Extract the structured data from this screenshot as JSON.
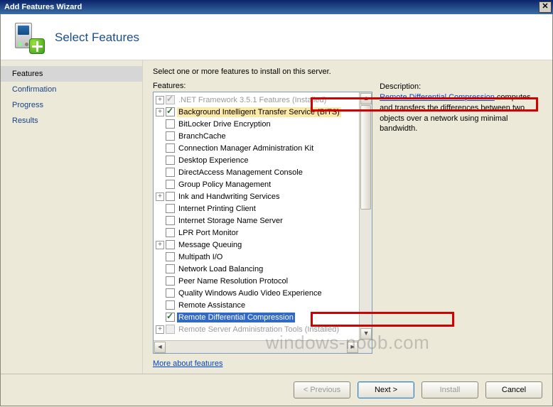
{
  "window": {
    "title": "Add Features Wizard"
  },
  "header": {
    "heading": "Select Features"
  },
  "sidebar": {
    "steps": [
      {
        "label": "Features",
        "active": true
      },
      {
        "label": "Confirmation",
        "active": false
      },
      {
        "label": "Progress",
        "active": false
      },
      {
        "label": "Results",
        "active": false
      }
    ]
  },
  "content": {
    "instruction": "Select one or more features to install on this server.",
    "features_label": "Features:",
    "description_label": "Description:",
    "description_link": "Remote Differential Compression",
    "description_text": " computes and transfers the differences between two objects over a network using minimal bandwidth.",
    "more_link": "More about features",
    "features": [
      {
        "label": ".NET Framework 3.5.1 Features  (Installed)",
        "checked": true,
        "disabled": true,
        "expandable": true
      },
      {
        "label": "Background Intelligent Transfer Service (BITS)",
        "checked": true,
        "expandable": true,
        "highlight": true
      },
      {
        "label": "BitLocker Drive Encryption"
      },
      {
        "label": "BranchCache"
      },
      {
        "label": "Connection Manager Administration Kit"
      },
      {
        "label": "Desktop Experience"
      },
      {
        "label": "DirectAccess Management Console"
      },
      {
        "label": "Group Policy Management"
      },
      {
        "label": "Ink and Handwriting Services",
        "expandable": true
      },
      {
        "label": "Internet Printing Client"
      },
      {
        "label": "Internet Storage Name Server"
      },
      {
        "label": "LPR Port Monitor"
      },
      {
        "label": "Message Queuing",
        "expandable": true
      },
      {
        "label": "Multipath I/O"
      },
      {
        "label": "Network Load Balancing"
      },
      {
        "label": "Peer Name Resolution Protocol"
      },
      {
        "label": "Quality Windows Audio Video Experience"
      },
      {
        "label": "Remote Assistance"
      },
      {
        "label": "Remote Differential Compression",
        "checked": true,
        "selected": true
      },
      {
        "label": "Remote Server Administration Tools  (Installed)",
        "disabled": true,
        "expandable": true
      }
    ]
  },
  "buttons": {
    "previous": "< Previous",
    "next": "Next >",
    "install": "Install",
    "cancel": "Cancel"
  },
  "watermark": "windows-noob.com"
}
